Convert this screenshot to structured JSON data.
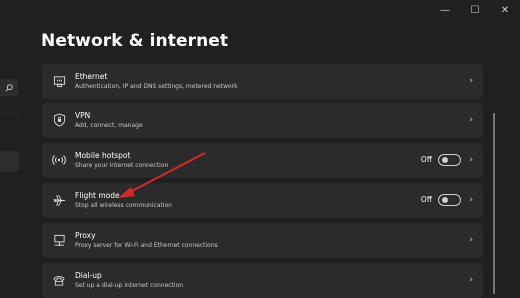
{
  "page": {
    "title": "Network & internet"
  },
  "window_controls": {
    "minimize": "—",
    "maximize": "☐",
    "close": "✕"
  },
  "cards": [
    {
      "title": "Ethernet",
      "subtitle": "Authentication, IP and DNS settings, metered network",
      "icon": "ethernet-icon"
    },
    {
      "title": "VPN",
      "subtitle": "Add, connect, manage",
      "icon": "vpn-shield-icon"
    },
    {
      "title": "Mobile hotspot",
      "subtitle": "Share your internet connection",
      "icon": "hotspot-icon",
      "toggle_label": "Off",
      "toggle_on": false
    },
    {
      "title": "Flight mode",
      "subtitle": "Stop all wireless communication",
      "icon": "airplane-icon",
      "toggle_label": "Off",
      "toggle_on": false
    },
    {
      "title": "Proxy",
      "subtitle": "Proxy server for Wi-Fi and Ethernet connections",
      "icon": "proxy-icon"
    },
    {
      "title": "Dial-up",
      "subtitle": "Set up a dial-up internet connection",
      "icon": "dialup-icon"
    }
  ],
  "colors": {
    "background": "#202020",
    "card": "#2b2b2b",
    "annotation_arrow": "#d42a2a"
  }
}
